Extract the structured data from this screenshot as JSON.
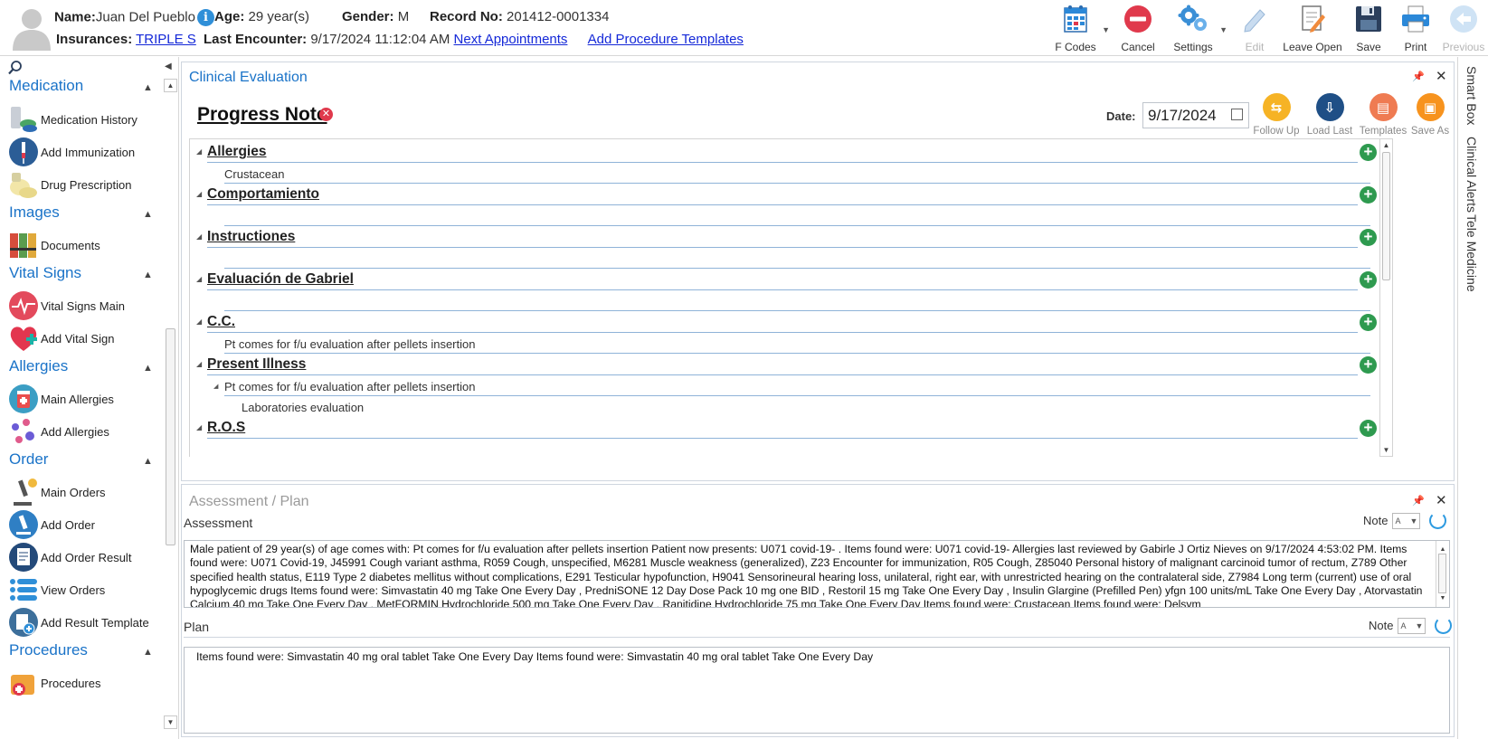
{
  "patient": {
    "name_label": "Name:",
    "name": "Juan Del Pueblo",
    "info_icon": "i",
    "age_label": "Age:",
    "age": "29 year(s)",
    "gender_label": "Gender:",
    "gender": "M",
    "record_label": "Record No:",
    "record": "201412-0001334",
    "insurances_label": "Insurances:",
    "insurance": "TRIPLE S",
    "last_encounter_label": "Last Encounter:",
    "last_encounter": "9/17/2024 11:12:04 AM",
    "next_appointments": "Next Appointments",
    "add_procedure_templates": "Add Procedure Templates"
  },
  "toolbar": {
    "fcodes": "F Codes",
    "cancel": "Cancel",
    "settings": "Settings",
    "edit": "Edit",
    "leave_open": "Leave Open",
    "save": "Save",
    "print": "Print",
    "previous": "Previous"
  },
  "sidebar": {
    "sections": {
      "medication": "Medication",
      "images": "Images",
      "vital_signs": "Vital Signs",
      "allergies": "Allergies",
      "order": "Order",
      "procedures": "Procedures"
    },
    "items": {
      "medication_history": "Medication History",
      "add_immunization": "Add Immunization",
      "drug_prescription": "Drug Prescription",
      "documents": "Documents",
      "vital_signs_main": "Vital Signs Main",
      "add_vital_sign": "Add Vital Sign",
      "main_allergies": "Main Allergies",
      "add_allergies": "Add Allergies",
      "main_orders": "Main Orders",
      "add_order": "Add Order",
      "add_order_result": "Add Order Result",
      "view_orders": "View Orders",
      "add_result_template": "Add Result Template",
      "procedures": "Procedures"
    }
  },
  "right_tabs": {
    "smart_box": "Smart Box",
    "clinical_alerts": "Clinical Alerts",
    "tele_medicine": "Tele Medicine"
  },
  "clinical": {
    "panel_title": "Clinical Evaluation",
    "note_title": "Progress Note",
    "date_label": "Date:",
    "date_value": "9/17/2024",
    "actions": {
      "follow_up": "Follow Up",
      "load_last": "Load Last",
      "templates": "Templates",
      "save_as": "Save As"
    },
    "sections": [
      {
        "title": "Allergies",
        "line1": "Crustacean"
      },
      {
        "title": "Comportamiento",
        "line1": ""
      },
      {
        "title": "Instructiones",
        "line1": ""
      },
      {
        "title": "Evaluación de Gabriel",
        "line1": ""
      },
      {
        "title": "C.C.",
        "line1": "Pt comes for f/u evaluation after pellets insertion"
      },
      {
        "title": "Present Illness",
        "line1": "Pt comes for f/u evaluation after pellets insertion",
        "line2": "Laboratories evaluation"
      },
      {
        "title": "R.O.S",
        "line1": ""
      }
    ]
  },
  "assessment_plan": {
    "panel_title": "Assessment / Plan",
    "assessment_label": "Assessment",
    "note_label": "Note",
    "assessment_text": "Male patient of 29 year(s) of age comes with:  Pt comes for f/u evaluation after pellets insertion  Patient now presents:  U071 covid-19- . Items found were:  U071 covid-19-    Allergies last reviewed by Gabirle J Ortiz Nieves on 9/17/2024 4:53:02 PM.     Items found were:  U071 Covid-19, J45991 Cough variant asthma, R059 Cough, unspecified, M6281 Muscle weakness (generalized), Z23 Encounter for immunization, R05 Cough, Z85040 Personal history of malignant carcinoid tumor of rectum, Z789 Other specified health status, E119 Type 2 diabetes mellitus without complications, E291 Testicular hypofunction, H9041 Sensorineural hearing loss, unilateral, right ear, with unrestricted hearing on the contralateral side, Z7984 Long term (current) use of oral hypoglycemic drugs  Items found were:  Simvastatin 40 mg Take One Every Day , PredniSONE 12 Day Dose Pack 10 mg one BID , Restoril 15 mg Take One Every Day , Insulin Glargine (Prefilled Pen) yfgn 100 units/mL Take One Every Day , Atorvastatin Calcium 40 mg Take One Every Day , MetFORMIN Hydrochloride 500 mg Take One Every Day , Ranitidine Hydrochloride 75 mg Take One Every Day   Items found were:  Crustacean      Items found were:  Delsym",
    "plan_label": "Plan",
    "plan_text": "Items found were:  Simvastatin 40 mg oral tablet Take One Every Day   Items found were:  Simvastatin 40 mg oral tablet Take One Every Day"
  },
  "colors": {
    "accent_blue": "#1a73c8",
    "link_blue": "#1428d8",
    "add_green": "#2e9a4f",
    "cancel_red": "#e0394c",
    "follow_up": "#f6b325",
    "load_last": "#1f4f86",
    "templates": "#ef7b52",
    "save_as": "#f7931e"
  }
}
